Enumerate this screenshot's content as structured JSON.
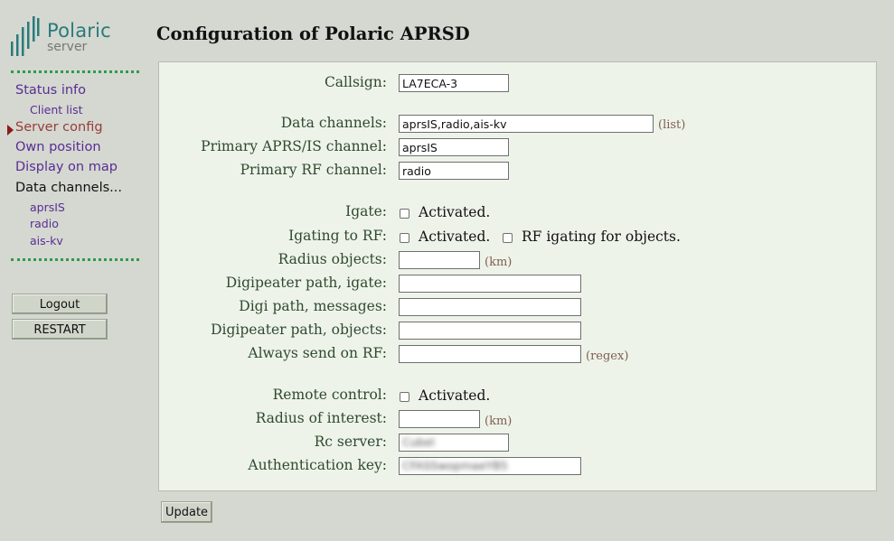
{
  "logo": {
    "title": "Polaric",
    "subtitle": "server",
    "accent_color": "#2a7a7c"
  },
  "sidebar": {
    "items": [
      {
        "label": "Status info",
        "state": "link"
      },
      {
        "label": "Client list",
        "state": "sub-link"
      },
      {
        "label": "Server config",
        "state": "active"
      },
      {
        "label": "Own position",
        "state": "link"
      },
      {
        "label": "Display on map",
        "state": "link"
      },
      {
        "label": "Data channels...",
        "state": "heading"
      },
      {
        "label": "aprsIS",
        "state": "sub-link"
      },
      {
        "label": "radio",
        "state": "sub-link"
      },
      {
        "label": "ais-kv",
        "state": "sub-link"
      }
    ],
    "buttons": {
      "logout": "Logout",
      "restart": "RESTART"
    }
  },
  "page": {
    "title": "Configuration of Polaric APRSD"
  },
  "form": {
    "callsign": {
      "label": "Callsign:",
      "value": "LA7ECA-3"
    },
    "data_channels": {
      "label": "Data channels:",
      "value": "aprsIS,radio,ais-kv",
      "hint": "(list)"
    },
    "primary_aprsis": {
      "label": "Primary APRS/IS channel:",
      "value": "aprsIS"
    },
    "primary_rf": {
      "label": "Primary RF channel:",
      "value": "radio"
    },
    "igate": {
      "label": "Igate:",
      "checkbox": "Activated.",
      "checked": false
    },
    "igating_rf": {
      "label": "Igating to RF:",
      "checkbox": "Activated.",
      "checked": false,
      "checkbox2": "RF igating for objects.",
      "checked2": false
    },
    "radius_objects": {
      "label": "Radius objects:",
      "value": "",
      "hint": "(km)"
    },
    "digi_path_igate": {
      "label": "Digipeater path, igate:",
      "value": ""
    },
    "digi_path_messages": {
      "label": "Digi path, messages:",
      "value": ""
    },
    "digi_path_objects": {
      "label": "Digipeater path, objects:",
      "value": ""
    },
    "always_send_rf": {
      "label": "Always send on RF:",
      "value": "",
      "hint": "(regex)"
    },
    "remote_control": {
      "label": "Remote control:",
      "checkbox": "Activated.",
      "checked": false
    },
    "radius_interest": {
      "label": "Radius of interest:",
      "value": "",
      "hint": "(km)"
    },
    "rc_server": {
      "label": "Rc server:",
      "value": "Cubel"
    },
    "auth_key": {
      "label": "Authentication key:",
      "value": "CFASSwopmaeYB5"
    },
    "update_label": "Update"
  }
}
